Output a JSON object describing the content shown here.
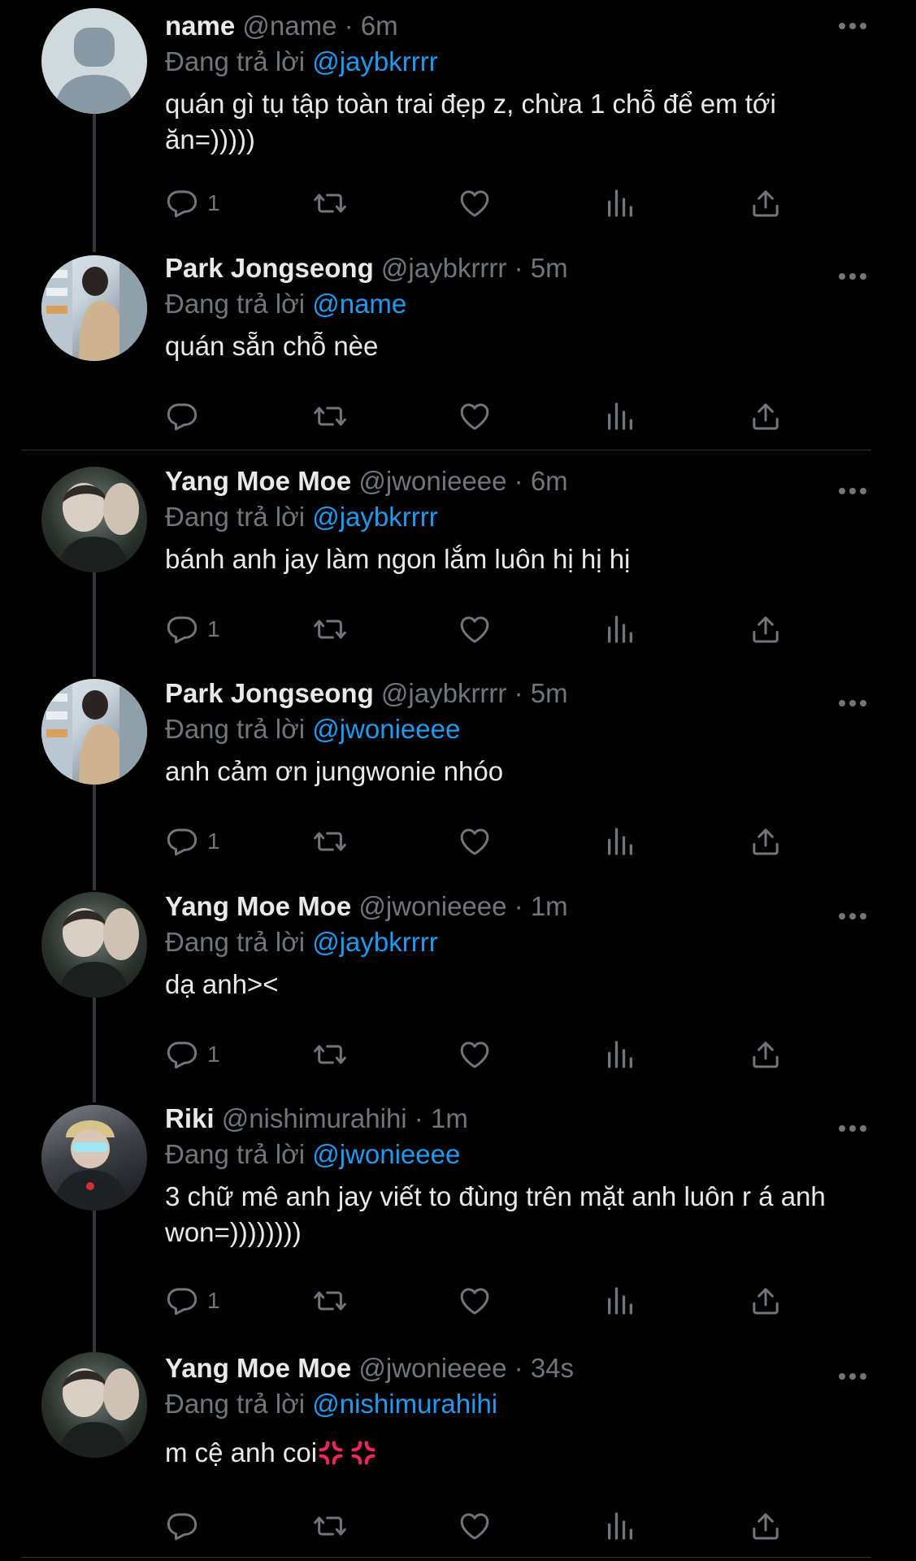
{
  "reply_prefix": "Đang trả lời",
  "tweets": [
    {
      "name": "name",
      "handle": "@name",
      "time": "6m",
      "reply_to": "@jaybkrrrr",
      "text": "quán gì tụ tập toàn trai đẹp z, chừa 1 chỗ để em tới ăn=)))))",
      "reply_count": "1",
      "avatar": "default-avatar"
    },
    {
      "name": "Park Jongseong",
      "handle": "@jaybkrrrr",
      "time": "5m",
      "reply_to": "@name",
      "text": "quán sẵn chỗ nèe",
      "reply_count": "",
      "avatar": "park-jongseong-avatar"
    },
    {
      "name": "Yang Moe Moe",
      "handle": "@jwonieeee",
      "time": "6m",
      "reply_to": "@jaybkrrrr",
      "text": "bánh anh jay làm ngon lắm luôn hị hị hị",
      "reply_count": "1",
      "avatar": "yang-moe-moe-avatar"
    },
    {
      "name": "Park Jongseong",
      "handle": "@jaybkrrrr",
      "time": "5m",
      "reply_to": "@jwonieeee",
      "text": "anh cảm ơn jungwonie nhóo",
      "reply_count": "1",
      "avatar": "park-jongseong-avatar"
    },
    {
      "name": "Yang Moe Moe",
      "handle": "@jwonieeee",
      "time": "1m",
      "reply_to": "@jaybkrrrr",
      "text": "dạ anh><",
      "reply_count": "1",
      "avatar": "yang-moe-moe-avatar"
    },
    {
      "name": "Riki",
      "handle": "@nishimurahihi",
      "time": "1m",
      "reply_to": "@jwonieeee",
      "text": "3 chữ mê anh jay viết to đùng trên mặt anh luôn r á anh won=))))))))",
      "reply_count": "1",
      "avatar": "riki-avatar"
    },
    {
      "name": "Yang Moe Moe",
      "handle": "@jwonieeee",
      "time": "34s",
      "reply_to": "@nishimurahihi",
      "text": "m cệ anh coi",
      "reply_count": "",
      "avatar": "yang-moe-moe-avatar",
      "emoji": [
        "anger-symbol",
        "anger-symbol"
      ]
    }
  ],
  "colors": {
    "background": "#000000",
    "text": "#e7e9ea",
    "muted": "#71767b",
    "mention": "#1d9bf0",
    "line": "#333639",
    "anger": "#f4245e"
  }
}
